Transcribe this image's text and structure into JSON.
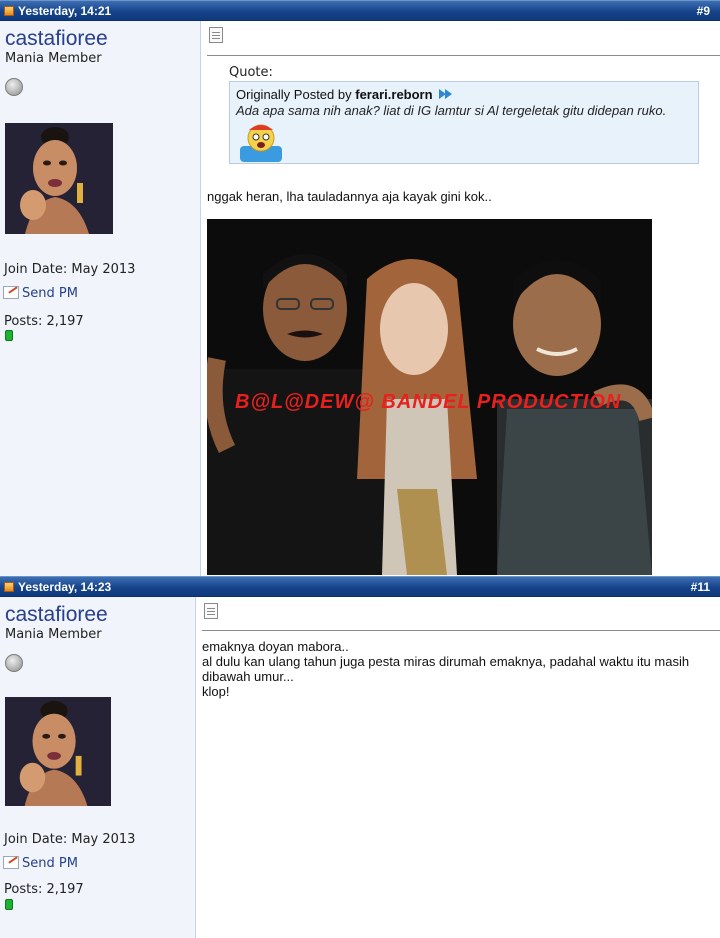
{
  "posts": [
    {
      "date": "Yesterday, 14:21",
      "number": "#9",
      "user": {
        "username": "castafioree",
        "title": "Mania Member",
        "join_date": "Join Date: May 2013",
        "send_pm": "Send PM",
        "posts": "Posts: 2,197"
      },
      "quote": {
        "label": "Quote:",
        "posted_by_prefix": "Originally Posted by",
        "author": "ferari.reborn",
        "text": "Ada apa sama nih anak? liat di IG lamtur si Al tergeletak gitu didepan ruko."
      },
      "body": "nggak heran, lha tauladannya aja kayak gini kok..",
      "image_watermark": "B@L@DEW@ BANDEL PRODUCTION"
    },
    {
      "date": "Yesterday, 14:23",
      "number": "#11",
      "user": {
        "username": "castafioree",
        "title": "Mania Member",
        "join_date": "Join Date: May 2013",
        "send_pm": "Send PM",
        "posts": "Posts: 2,197"
      },
      "body_lines": [
        "emaknya doyan mabora..",
        "al dulu kan ulang tahun juga pesta miras dirumah emaknya, padahal waktu itu masih",
        "dibawah umur...",
        "klop!"
      ]
    }
  ],
  "icons": {
    "post_icon": "post-status-icon",
    "online": "offline-status-icon",
    "pm": "send-pm-icon",
    "doc": "post-doc-icon",
    "quote_link": "view-post-arrow-icon",
    "reputation": "reputation-icon"
  },
  "colors": {
    "header_bar": "#16438a",
    "user_panel": "#f1f5fb",
    "quote_bg": "#e8f2fb",
    "username": "#26408b",
    "watermark": "#e8201e",
    "reputation": "#1db231"
  }
}
